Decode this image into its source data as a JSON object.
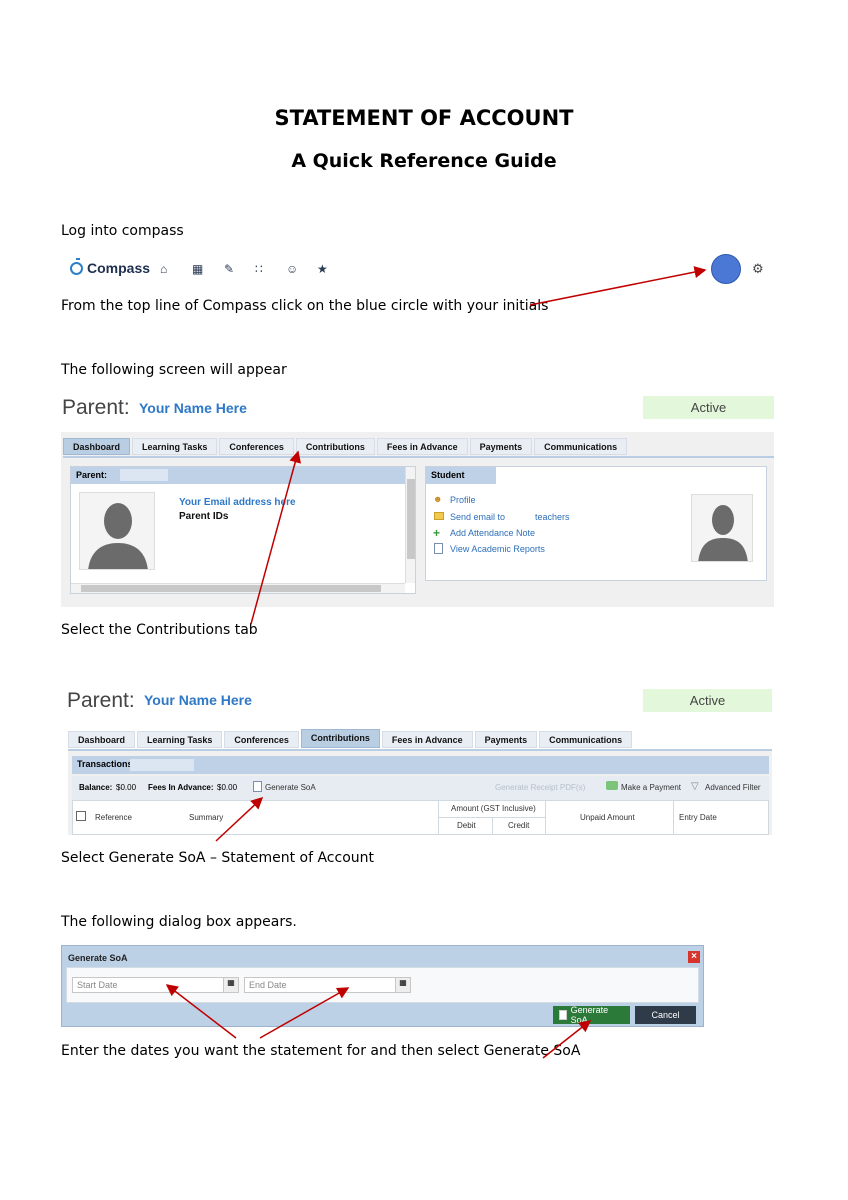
{
  "heading": {
    "title": "STATEMENT OF ACCOUNT",
    "subtitle": "A Quick Reference Guide"
  },
  "steps": {
    "login": "Log into compass",
    "top_line": "From the top line of Compass click on the blue circle with your initials",
    "screen_appears": "The following screen will appear",
    "select_contrib": "Select the Contributions tab",
    "select_generate": "Select Generate SoA – Statement of Account",
    "dialog_appears": "The following dialog box appears.",
    "enter_dates": "Enter the dates you want the statement for and then select Generate SoA"
  },
  "compass_bar": {
    "logo": "Compass",
    "icons": [
      "home-icon",
      "calendar-icon",
      "pencil-icon",
      "grid-icon",
      "people-icon",
      "star-icon"
    ],
    "glyphs": [
      "⌂",
      "▦",
      "✎",
      "∷",
      "☺",
      "★"
    ],
    "gear_glyph": "⚙",
    "avatar_color": "#4a78d4"
  },
  "parent_screen": {
    "label": "Parent:",
    "name": "Your Name Here",
    "status": "Active",
    "tabs": [
      "Dashboard",
      "Learning Tasks",
      "Conferences",
      "Contributions",
      "Fees in Advance",
      "Payments",
      "Communications"
    ],
    "parent_box_title": "Parent:",
    "email": "Your Email address here",
    "parent_ids": "Parent IDs",
    "student_box_title": "Student",
    "student_links": [
      "Profile",
      "Send email to",
      "Add Attendance Note",
      "View Academic Reports"
    ],
    "teachers": "teachers"
  },
  "contrib_screen": {
    "label": "Parent:",
    "name": "Your Name Here",
    "status": "Active",
    "transactions": "Transactions:",
    "balance_label": "Balance:",
    "balance_value": "$0.00",
    "fees_label": "Fees In Advance:",
    "fees_value": "$0.00",
    "generate_soa": "Generate SoA",
    "receipt": "Generate Receipt PDF(s)",
    "make_payment": "Make a Payment",
    "advanced_filter": "Advanced Filter",
    "columns": {
      "reference": "Reference",
      "summary": "Summary",
      "amount": "Amount (GST Inclusive)",
      "debit": "Debit",
      "credit": "Credit",
      "unpaid": "Unpaid Amount",
      "entry_date": "Entry Date"
    }
  },
  "dialog": {
    "title": "Generate SoA",
    "start_placeholder": "Start Date",
    "end_placeholder": "End Date",
    "generate_button": "Generate SoA",
    "cancel_button": "Cancel"
  },
  "colors": {
    "accent_blue": "#2e78c8",
    "arrow_red": "#c00000",
    "active_green": "#e3f8da"
  }
}
